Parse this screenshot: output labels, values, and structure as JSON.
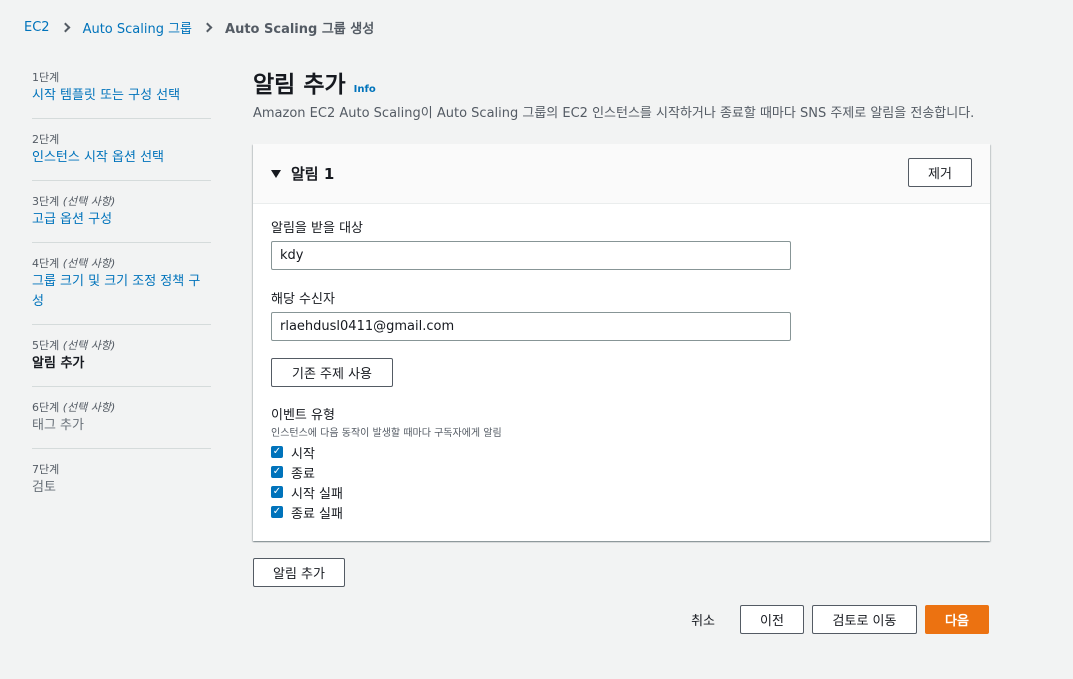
{
  "breadcrumb": {
    "items": [
      "EC2",
      "Auto Scaling 그룹",
      "Auto Scaling 그룹 생성"
    ]
  },
  "steps": [
    {
      "num": "1단계",
      "optional": "",
      "title": "시작 템플릿 또는 구성 선택",
      "state": "link"
    },
    {
      "num": "2단계",
      "optional": "",
      "title": "인스턴스 시작 옵션 선택",
      "state": "link"
    },
    {
      "num": "3단계",
      "optional": "(선택 사항)",
      "title": "고급 옵션 구성",
      "state": "link"
    },
    {
      "num": "4단계",
      "optional": "(선택 사항)",
      "title": "그룹 크기 및 크기 조정 정책 구성",
      "state": "link"
    },
    {
      "num": "5단계",
      "optional": "(선택 사항)",
      "title": "알림 추가",
      "state": "current"
    },
    {
      "num": "6단계",
      "optional": "(선택 사항)",
      "title": "태그 추가",
      "state": "disabled"
    },
    {
      "num": "7단계",
      "optional": "",
      "title": "검토",
      "state": "disabled"
    }
  ],
  "header": {
    "title": "알림 추가",
    "info": "Info",
    "description": "Amazon EC2 Auto Scaling이 Auto Scaling 그룹의 EC2 인스턴스를 시작하거나 종료할 때마다 SNS 주제로 알림을 전송합니다."
  },
  "notification": {
    "title": "알림 1",
    "remove_label": "제거",
    "recipient_label": "알림을 받을 대상",
    "recipient_value": "kdy",
    "subscribers_label": "해당 수신자",
    "subscribers_value": "rlaehdusl0411@gmail.com",
    "existing_topic_label": "기존 주제 사용",
    "event_type_label": "이벤트 유형",
    "event_type_desc": "인스턴스에 다음 동작이 발생할 때마다 구독자에게 알림",
    "events": [
      {
        "label": "시작",
        "checked": true
      },
      {
        "label": "종료",
        "checked": true
      },
      {
        "label": "시작 실패",
        "checked": true
      },
      {
        "label": "종료 실패",
        "checked": true
      }
    ]
  },
  "actions": {
    "add_notification": "알림 추가",
    "cancel": "취소",
    "previous": "이전",
    "skip_to_review": "검토로 이동",
    "next": "다음"
  },
  "colors": {
    "link": "#0073bb",
    "primary": "#ec7211",
    "background": "#f2f3f3"
  }
}
